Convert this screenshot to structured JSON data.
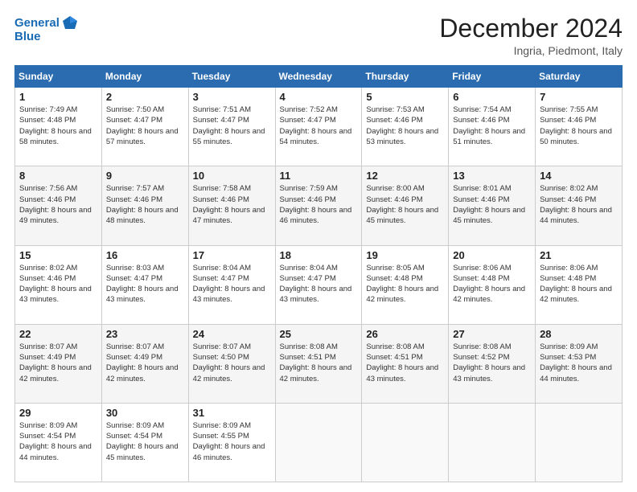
{
  "header": {
    "logo_line1": "General",
    "logo_line2": "Blue",
    "month": "December 2024",
    "location": "Ingria, Piedmont, Italy"
  },
  "weekdays": [
    "Sunday",
    "Monday",
    "Tuesday",
    "Wednesday",
    "Thursday",
    "Friday",
    "Saturday"
  ],
  "weeks": [
    [
      {
        "day": "1",
        "sunrise": "Sunrise: 7:49 AM",
        "sunset": "Sunset: 4:48 PM",
        "daylight": "Daylight: 8 hours and 58 minutes."
      },
      {
        "day": "2",
        "sunrise": "Sunrise: 7:50 AM",
        "sunset": "Sunset: 4:47 PM",
        "daylight": "Daylight: 8 hours and 57 minutes."
      },
      {
        "day": "3",
        "sunrise": "Sunrise: 7:51 AM",
        "sunset": "Sunset: 4:47 PM",
        "daylight": "Daylight: 8 hours and 55 minutes."
      },
      {
        "day": "4",
        "sunrise": "Sunrise: 7:52 AM",
        "sunset": "Sunset: 4:47 PM",
        "daylight": "Daylight: 8 hours and 54 minutes."
      },
      {
        "day": "5",
        "sunrise": "Sunrise: 7:53 AM",
        "sunset": "Sunset: 4:46 PM",
        "daylight": "Daylight: 8 hours and 53 minutes."
      },
      {
        "day": "6",
        "sunrise": "Sunrise: 7:54 AM",
        "sunset": "Sunset: 4:46 PM",
        "daylight": "Daylight: 8 hours and 51 minutes."
      },
      {
        "day": "7",
        "sunrise": "Sunrise: 7:55 AM",
        "sunset": "Sunset: 4:46 PM",
        "daylight": "Daylight: 8 hours and 50 minutes."
      }
    ],
    [
      {
        "day": "8",
        "sunrise": "Sunrise: 7:56 AM",
        "sunset": "Sunset: 4:46 PM",
        "daylight": "Daylight: 8 hours and 49 minutes."
      },
      {
        "day": "9",
        "sunrise": "Sunrise: 7:57 AM",
        "sunset": "Sunset: 4:46 PM",
        "daylight": "Daylight: 8 hours and 48 minutes."
      },
      {
        "day": "10",
        "sunrise": "Sunrise: 7:58 AM",
        "sunset": "Sunset: 4:46 PM",
        "daylight": "Daylight: 8 hours and 47 minutes."
      },
      {
        "day": "11",
        "sunrise": "Sunrise: 7:59 AM",
        "sunset": "Sunset: 4:46 PM",
        "daylight": "Daylight: 8 hours and 46 minutes."
      },
      {
        "day": "12",
        "sunrise": "Sunrise: 8:00 AM",
        "sunset": "Sunset: 4:46 PM",
        "daylight": "Daylight: 8 hours and 45 minutes."
      },
      {
        "day": "13",
        "sunrise": "Sunrise: 8:01 AM",
        "sunset": "Sunset: 4:46 PM",
        "daylight": "Daylight: 8 hours and 45 minutes."
      },
      {
        "day": "14",
        "sunrise": "Sunrise: 8:02 AM",
        "sunset": "Sunset: 4:46 PM",
        "daylight": "Daylight: 8 hours and 44 minutes."
      }
    ],
    [
      {
        "day": "15",
        "sunrise": "Sunrise: 8:02 AM",
        "sunset": "Sunset: 4:46 PM",
        "daylight": "Daylight: 8 hours and 43 minutes."
      },
      {
        "day": "16",
        "sunrise": "Sunrise: 8:03 AM",
        "sunset": "Sunset: 4:47 PM",
        "daylight": "Daylight: 8 hours and 43 minutes."
      },
      {
        "day": "17",
        "sunrise": "Sunrise: 8:04 AM",
        "sunset": "Sunset: 4:47 PM",
        "daylight": "Daylight: 8 hours and 43 minutes."
      },
      {
        "day": "18",
        "sunrise": "Sunrise: 8:04 AM",
        "sunset": "Sunset: 4:47 PM",
        "daylight": "Daylight: 8 hours and 43 minutes."
      },
      {
        "day": "19",
        "sunrise": "Sunrise: 8:05 AM",
        "sunset": "Sunset: 4:48 PM",
        "daylight": "Daylight: 8 hours and 42 minutes."
      },
      {
        "day": "20",
        "sunrise": "Sunrise: 8:06 AM",
        "sunset": "Sunset: 4:48 PM",
        "daylight": "Daylight: 8 hours and 42 minutes."
      },
      {
        "day": "21",
        "sunrise": "Sunrise: 8:06 AM",
        "sunset": "Sunset: 4:48 PM",
        "daylight": "Daylight: 8 hours and 42 minutes."
      }
    ],
    [
      {
        "day": "22",
        "sunrise": "Sunrise: 8:07 AM",
        "sunset": "Sunset: 4:49 PM",
        "daylight": "Daylight: 8 hours and 42 minutes."
      },
      {
        "day": "23",
        "sunrise": "Sunrise: 8:07 AM",
        "sunset": "Sunset: 4:49 PM",
        "daylight": "Daylight: 8 hours and 42 minutes."
      },
      {
        "day": "24",
        "sunrise": "Sunrise: 8:07 AM",
        "sunset": "Sunset: 4:50 PM",
        "daylight": "Daylight: 8 hours and 42 minutes."
      },
      {
        "day": "25",
        "sunrise": "Sunrise: 8:08 AM",
        "sunset": "Sunset: 4:51 PM",
        "daylight": "Daylight: 8 hours and 42 minutes."
      },
      {
        "day": "26",
        "sunrise": "Sunrise: 8:08 AM",
        "sunset": "Sunset: 4:51 PM",
        "daylight": "Daylight: 8 hours and 43 minutes."
      },
      {
        "day": "27",
        "sunrise": "Sunrise: 8:08 AM",
        "sunset": "Sunset: 4:52 PM",
        "daylight": "Daylight: 8 hours and 43 minutes."
      },
      {
        "day": "28",
        "sunrise": "Sunrise: 8:09 AM",
        "sunset": "Sunset: 4:53 PM",
        "daylight": "Daylight: 8 hours and 44 minutes."
      }
    ],
    [
      {
        "day": "29",
        "sunrise": "Sunrise: 8:09 AM",
        "sunset": "Sunset: 4:54 PM",
        "daylight": "Daylight: 8 hours and 44 minutes."
      },
      {
        "day": "30",
        "sunrise": "Sunrise: 8:09 AM",
        "sunset": "Sunset: 4:54 PM",
        "daylight": "Daylight: 8 hours and 45 minutes."
      },
      {
        "day": "31",
        "sunrise": "Sunrise: 8:09 AM",
        "sunset": "Sunset: 4:55 PM",
        "daylight": "Daylight: 8 hours and 46 minutes."
      },
      null,
      null,
      null,
      null
    ]
  ]
}
